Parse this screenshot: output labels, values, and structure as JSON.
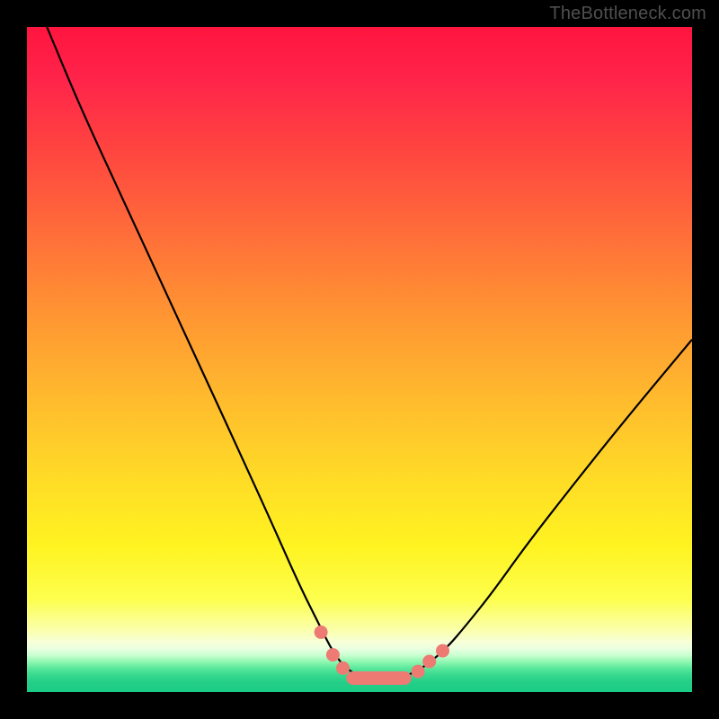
{
  "watermark": "TheBottleneck.com",
  "chart_data": {
    "type": "line",
    "title": "",
    "xlabel": "",
    "ylabel": "",
    "x_range": [
      0,
      100
    ],
    "y_range": [
      0,
      100
    ],
    "series": [
      {
        "name": "curve",
        "x": [
          3,
          8,
          14,
          20,
          26,
          32,
          37,
          41,
          44,
          46,
          48,
          50,
          52,
          54,
          56,
          58,
          60,
          63,
          66,
          70,
          75,
          82,
          90,
          100
        ],
        "y": [
          100,
          88,
          75,
          62,
          49,
          36,
          25,
          16,
          10,
          6,
          3.5,
          2.4,
          2.0,
          2.0,
          2.2,
          2.8,
          4.0,
          6.5,
          10,
          15,
          22,
          31,
          41,
          53
        ]
      }
    ],
    "markers": {
      "name": "near-minimum-dots",
      "x": [
        44.2,
        46.0,
        47.5,
        58.8,
        60.5,
        62.5
      ],
      "y": [
        9.0,
        5.6,
        3.6,
        3.1,
        4.6,
        6.2
      ]
    },
    "flat_segment": {
      "name": "minimum-plateau",
      "x_start": 48.0,
      "x_end": 57.8,
      "y": 2.1
    },
    "gradient_stops": [
      {
        "pos": 0.0,
        "color": "#ff153f"
      },
      {
        "pos": 0.3,
        "color": "#ff6a3a"
      },
      {
        "pos": 0.67,
        "color": "#ffd927"
      },
      {
        "pos": 0.9,
        "color": "#fbffa8"
      },
      {
        "pos": 1.0,
        "color": "#1bcc85"
      }
    ]
  }
}
